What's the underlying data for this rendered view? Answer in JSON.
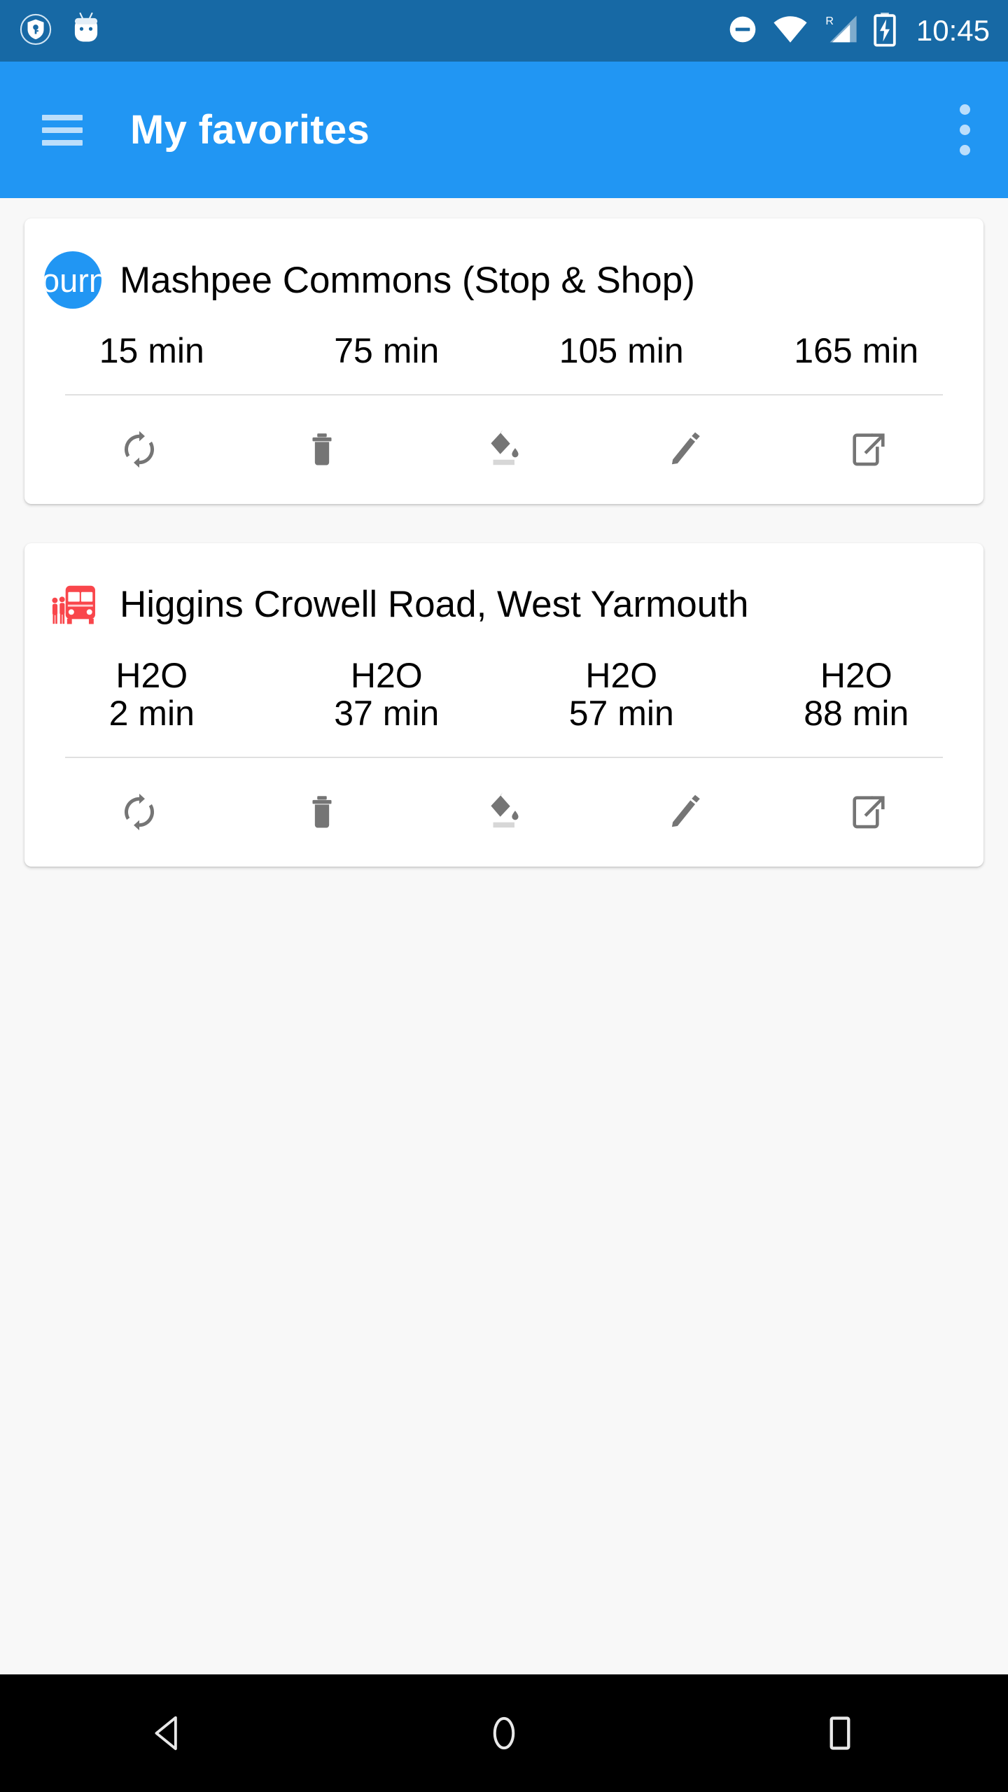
{
  "status_bar": {
    "background": "#1769a5",
    "clock": "10:45",
    "left_icons": [
      {
        "name": "vpn-key-shield-icon",
        "label": "VPN"
      },
      {
        "name": "android-mascot-icon",
        "label": "Android"
      }
    ],
    "right_icons": [
      {
        "name": "do-not-disturb-icon",
        "label": "Do not disturb"
      },
      {
        "name": "wifi-icon",
        "label": "Wi-Fi"
      },
      {
        "name": "signal-roaming-icon",
        "label": "R"
      },
      {
        "name": "battery-charging-icon",
        "label": "Charging"
      }
    ]
  },
  "app_bar": {
    "background": "#2196f3",
    "title": "My favorites",
    "menu_icon": "hamburger-menu-icon",
    "overflow_icon": "more-vert-icon"
  },
  "actions": [
    {
      "name": "refresh-button",
      "label": "Refresh"
    },
    {
      "name": "delete-button",
      "label": "Delete"
    },
    {
      "name": "fill-color-button",
      "label": "Change color"
    },
    {
      "name": "edit-button",
      "label": "Edit"
    },
    {
      "name": "open-in-new-button",
      "label": "Open"
    }
  ],
  "cards": [
    {
      "id": "mashpee-commons",
      "icon": "avatar-circle",
      "avatar_text": "ourn",
      "avatar_color": "#2196f3",
      "title": "Mashpee Commons (Stop & Shop)",
      "times": [
        {
          "route": "",
          "mins": "15 min"
        },
        {
          "route": "",
          "mins": "75 min"
        },
        {
          "route": "",
          "mins": "105 min"
        },
        {
          "route": "",
          "mins": "165 min"
        }
      ]
    },
    {
      "id": "higgins-crowell-road",
      "icon": "bus-stop-icon",
      "icon_color": "#f9464b",
      "title": "Higgins Crowell Road, West Yarmouth",
      "times": [
        {
          "route": "H2O",
          "mins": "2 min"
        },
        {
          "route": "H2O",
          "mins": "37 min"
        },
        {
          "route": "H2O",
          "mins": "57 min"
        },
        {
          "route": "H2O",
          "mins": "88 min"
        }
      ]
    }
  ],
  "nav_bar": {
    "background": "#000000",
    "buttons": [
      {
        "name": "nav-back-button",
        "label": "Back"
      },
      {
        "name": "nav-home-button",
        "label": "Home"
      },
      {
        "name": "nav-recents-button",
        "label": "Recents"
      }
    ]
  }
}
